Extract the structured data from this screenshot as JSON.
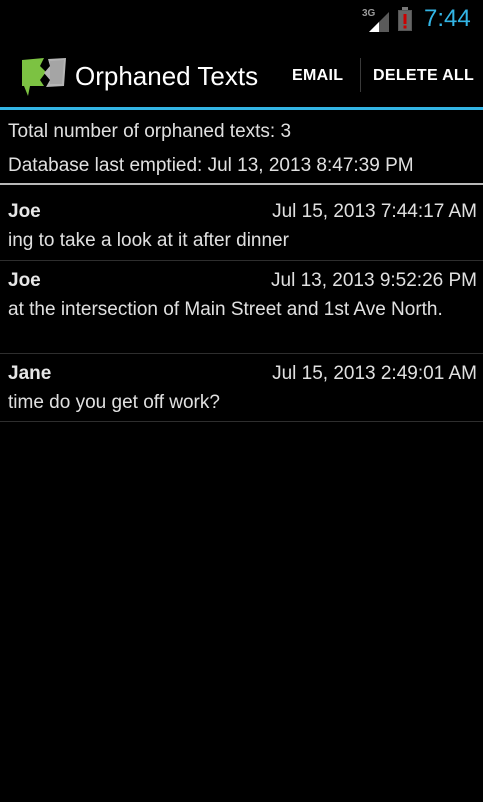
{
  "status_bar": {
    "network": "3G",
    "time": "7:44"
  },
  "action_bar": {
    "title": "Orphaned Texts",
    "email_label": "EMAIL",
    "delete_all_label": "DELETE ALL"
  },
  "summary": {
    "count_text": "Total number of orphaned texts: 3",
    "emptied_text": "Database last emptied: Jul 13, 2013 8:47:39 PM"
  },
  "messages": [
    {
      "sender": "Joe",
      "time": "Jul 15, 2013 7:44:17 AM",
      "body": "ing to take a look at it after dinner"
    },
    {
      "sender": "Joe",
      "time": "Jul 13, 2013 9:52:26 PM",
      "body": "at the intersection of Main Street and 1st Ave North."
    },
    {
      "sender": "Jane",
      "time": "Jul 15, 2013 2:49:01 AM",
      "body": "time do you get off work?"
    }
  ],
  "colors": {
    "accent": "#33b5e5",
    "battery_alert": "#cc0000"
  }
}
